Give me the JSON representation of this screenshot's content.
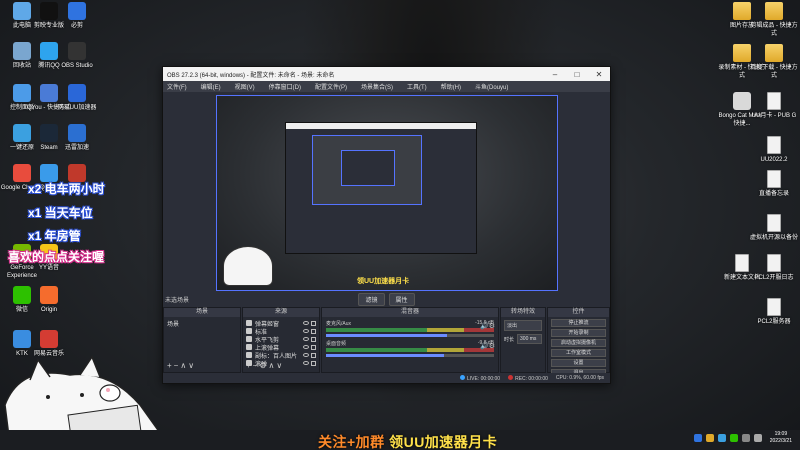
{
  "desktop": {
    "left_icons": [
      {
        "label": "此电脑",
        "color": "#5fa8e8"
      },
      {
        "label": "剪映专业版",
        "color": "#111111"
      },
      {
        "label": "必剪",
        "color": "#2f73e0"
      },
      {
        "label": "回收站",
        "color": "#7aa6cf"
      },
      {
        "label": "腾讯QQ",
        "color": "#2ea4ee"
      },
      {
        "label": "OBS Studio",
        "color": "#333333"
      },
      {
        "label": "控制面板",
        "color": "#4c9be8"
      },
      {
        "label": "QYou - 快捷方式",
        "color": "#4a7bd6"
      },
      {
        "label": "网易UU加速器",
        "color": "#2a67d8"
      },
      {
        "label": "一键还原",
        "color": "#3ba0e0"
      },
      {
        "label": "Steam",
        "color": "#1b2838"
      },
      {
        "label": "迅雷加速",
        "color": "#2b6fd1"
      },
      {
        "label": "Google Chrome",
        "color": "#e84c3d"
      },
      {
        "label": "QQ浏览器",
        "color": "#3a9bea"
      },
      {
        "label": "Apex",
        "color": "#c0392b"
      },
      {
        "label": "GeForce Experience",
        "color": "#76b900"
      },
      {
        "label": "YY语音",
        "color": "#f5c518"
      },
      {
        "label": "微信",
        "color": "#2dc100"
      },
      {
        "label": "Origin",
        "color": "#f56c2d"
      },
      {
        "label": "KTK",
        "color": "#3a8de0"
      },
      {
        "label": "网易云音乐",
        "color": "#d43c33"
      }
    ],
    "right_icons": [
      {
        "label": "图片存放",
        "type": "folder"
      },
      {
        "label": "剪辑成品 - 快捷方式",
        "type": "folder"
      },
      {
        "label": "录制素材 - 快捷方式",
        "type": "folder"
      },
      {
        "label": "百度下载 - 快捷方式",
        "type": "folder"
      },
      {
        "label": "Bongo Cat Mver - 快捷...",
        "type": "app"
      },
      {
        "label": "UU月卡 - PUB G",
        "type": "file"
      },
      {
        "label": "UU2022.2",
        "type": "file"
      },
      {
        "label": "直播备忘录",
        "type": "file"
      },
      {
        "label": "虚拟机开源以备份",
        "type": "file"
      },
      {
        "label": "新建文本文档",
        "type": "file"
      },
      {
        "label": "PCL2开服日志",
        "type": "file"
      },
      {
        "label": "PCL2服务器",
        "type": "file"
      }
    ]
  },
  "overlay": {
    "line1": "x2 电车两小时",
    "line2": "x1 当天车位",
    "line3": "x1 年房管",
    "line4": "喜欢的点点关注喔"
  },
  "obs": {
    "title": "OBS 27.2.3 (64-bit, windows) - 配置文件: 未命名 - 场景: 未命名",
    "menu": [
      "文件(F)",
      "编辑(E)",
      "视图(V)",
      "停靠窗口(D)",
      "配置文件(P)",
      "场景集合(S)",
      "工具(T)",
      "帮助(H)",
      "斗鱼(Douyu)"
    ],
    "preview_caption": "领UU加速器月卡",
    "scene_toolbar_label": "未选场景",
    "scene_buttons": [
      "滤镜",
      "属性"
    ],
    "docks": {
      "scenes": {
        "title": "场景",
        "items": [
          "场景"
        ]
      },
      "sources": {
        "title": "来源",
        "items": [
          "弹幕姬窗",
          "标准",
          "水平飞剪",
          "上滚弹幕",
          "副标：百人图片",
          "滚弹"
        ]
      },
      "mixer": {
        "title": "混音器",
        "channels": [
          {
            "name": "麦克风/Aux",
            "level": "-15.9 dB",
            "fader": 0.72
          },
          {
            "name": "桌面音频",
            "level": "-9.8 dB",
            "fader": 0.7
          }
        ]
      },
      "transitions": {
        "title": "转场特效",
        "effect": "淡出",
        "duration_label": "时长",
        "duration": "300 ms"
      },
      "controls": {
        "title": "控件",
        "buttons": [
          "停止推流",
          "开始录制",
          "启动虚拟摄像机",
          "工作室模式",
          "设置",
          "退出"
        ]
      }
    },
    "status": {
      "live": "LIVE: 00:00:00",
      "rec": "REC: 00:00:00",
      "cpu": "CPU: 0.9%, 60.00 fps"
    }
  },
  "taskbar": {
    "banner_prefix": "关注+加群 ",
    "banner_main": "领UU加速器月卡",
    "time": "19:09",
    "date": "2022/3/21"
  }
}
